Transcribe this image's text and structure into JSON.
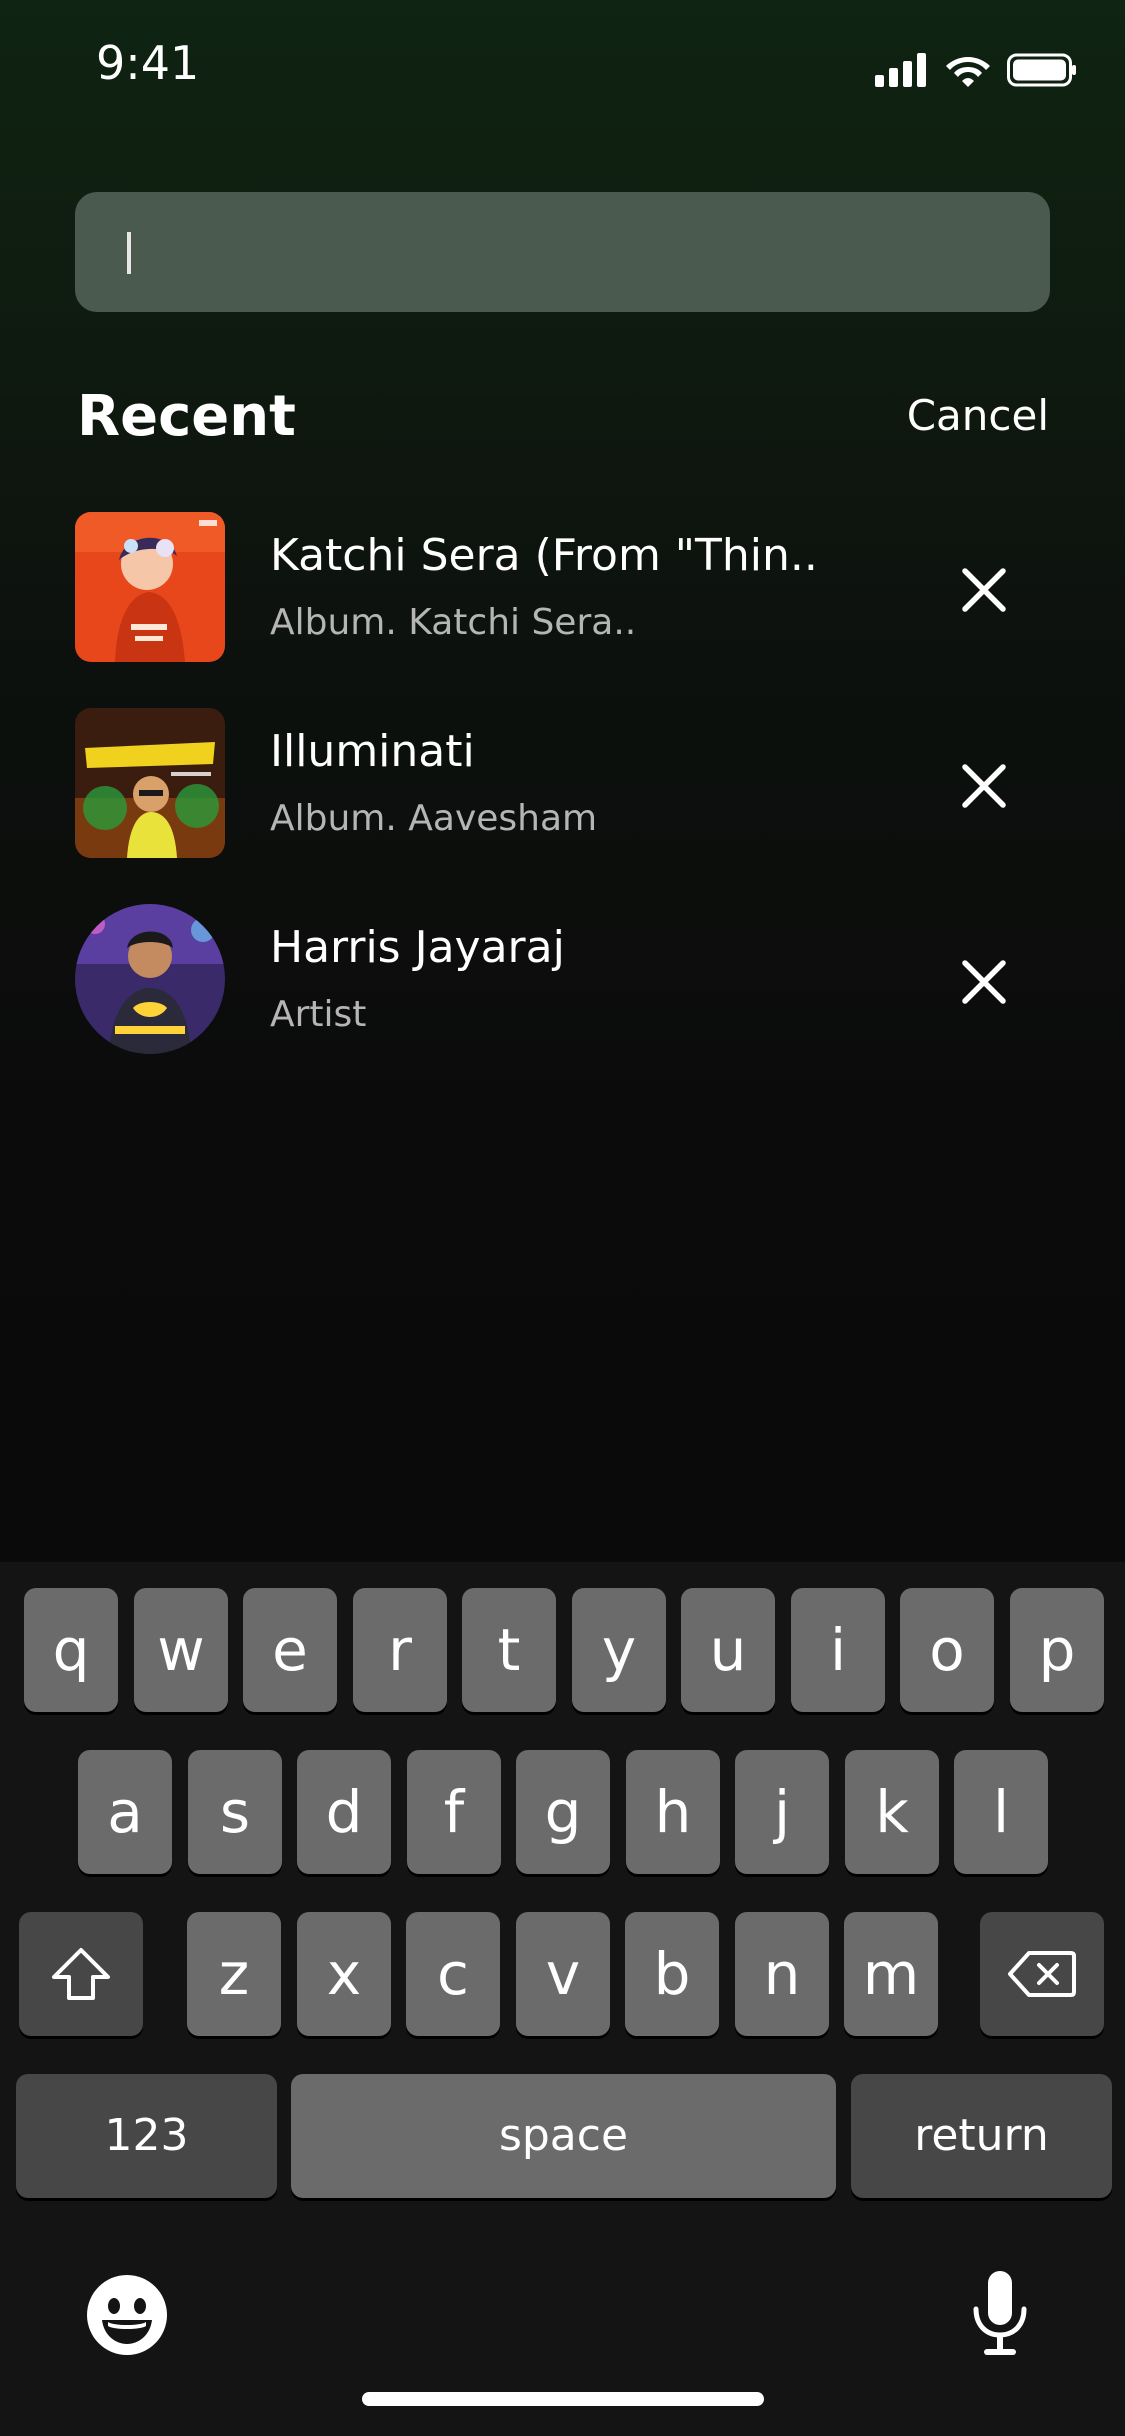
{
  "status_bar": {
    "time": "9:41",
    "icons": [
      "cellular-signal-icon",
      "wifi-icon",
      "battery-icon"
    ]
  },
  "search": {
    "value": "",
    "placeholder": ""
  },
  "recent": {
    "title": "Recent",
    "cancel_label": "Cancel",
    "items": [
      {
        "title": "Katchi Sera (From \"Thin..",
        "subtitle": "Album. Katchi Sera..",
        "artwork": "katchi-sera-album-art",
        "remove_icon": "close-icon"
      },
      {
        "title": "Illuminati",
        "subtitle": "Album. Aavesham",
        "artwork": "aavesham-album-art",
        "remove_icon": "close-icon"
      },
      {
        "title": "Harris Jayaraj",
        "subtitle": "Artist",
        "artwork": "harris-jayaraj-artist-photo",
        "remove_icon": "close-icon"
      }
    ]
  },
  "keyboard": {
    "row1": [
      "q",
      "w",
      "e",
      "r",
      "t",
      "y",
      "u",
      "i",
      "o",
      "p"
    ],
    "row2": [
      "a",
      "s",
      "d",
      "f",
      "g",
      "h",
      "j",
      "k",
      "l"
    ],
    "row3": [
      "z",
      "x",
      "c",
      "v",
      "b",
      "n",
      "m"
    ],
    "shift_icon": "shift-icon",
    "backspace_icon": "backspace-icon",
    "numbers_label": "123",
    "space_label": "space",
    "return_label": "return",
    "emoji_icon": "emoji-icon",
    "mic_icon": "microphone-icon"
  },
  "colors": {
    "background_top": "#0f2412",
    "search_field": "#4b5a4f",
    "key": "#6b6b6b",
    "key_dark": "#474747",
    "subtitle": "#b5b5b5"
  }
}
